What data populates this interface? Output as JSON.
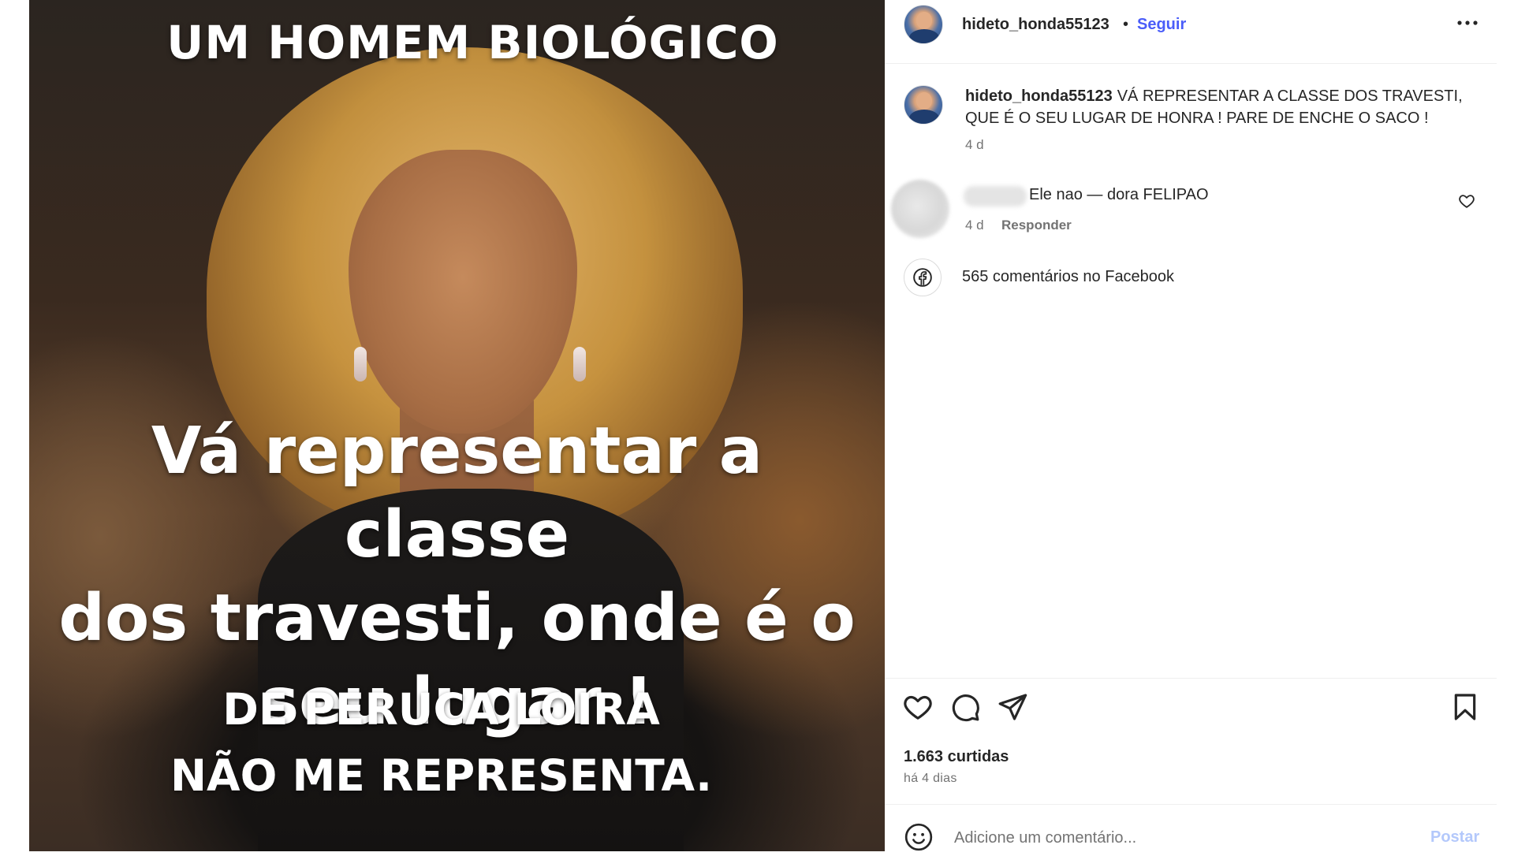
{
  "post_image": {
    "overlay_top": "UM HOMEM BIOLÓGICO",
    "overlay_mid_lines": [
      "Vá representar a classe",
      "dos travesti, onde é o",
      "seu lugar !"
    ],
    "overlay_bottom_lines": [
      "DE PERUCA LOIRA",
      "NÃO ME REPRESENTA."
    ]
  },
  "header": {
    "username": "hideto_honda55123",
    "separator": "•",
    "follow_label": "Seguir",
    "more_icon": "more-horizontal-icon"
  },
  "caption": {
    "username": "hideto_honda55123",
    "text": "VÁ REPRESENTAR A CLASSE DOS TRAVESTI, QUE É O SEU LUGAR DE HONRA ! PARE DE ENCHE O SACO !",
    "time": "4 d"
  },
  "comment": {
    "text": "Ele nao — dora FELIPAO",
    "time": "4 d",
    "reply_label": "Responder"
  },
  "facebook": {
    "label": "565 comentários no Facebook",
    "icon": "facebook-icon"
  },
  "actions": {
    "likes": "1.663 curtidas",
    "ago": "há 4 dias"
  },
  "comment_box": {
    "placeholder": "Adicione um comentário...",
    "post_label": "Postar"
  },
  "colors": {
    "accent": "#4a5df9",
    "post_disabled": "#b3c8fb",
    "muted": "#737373",
    "text": "#262626"
  }
}
